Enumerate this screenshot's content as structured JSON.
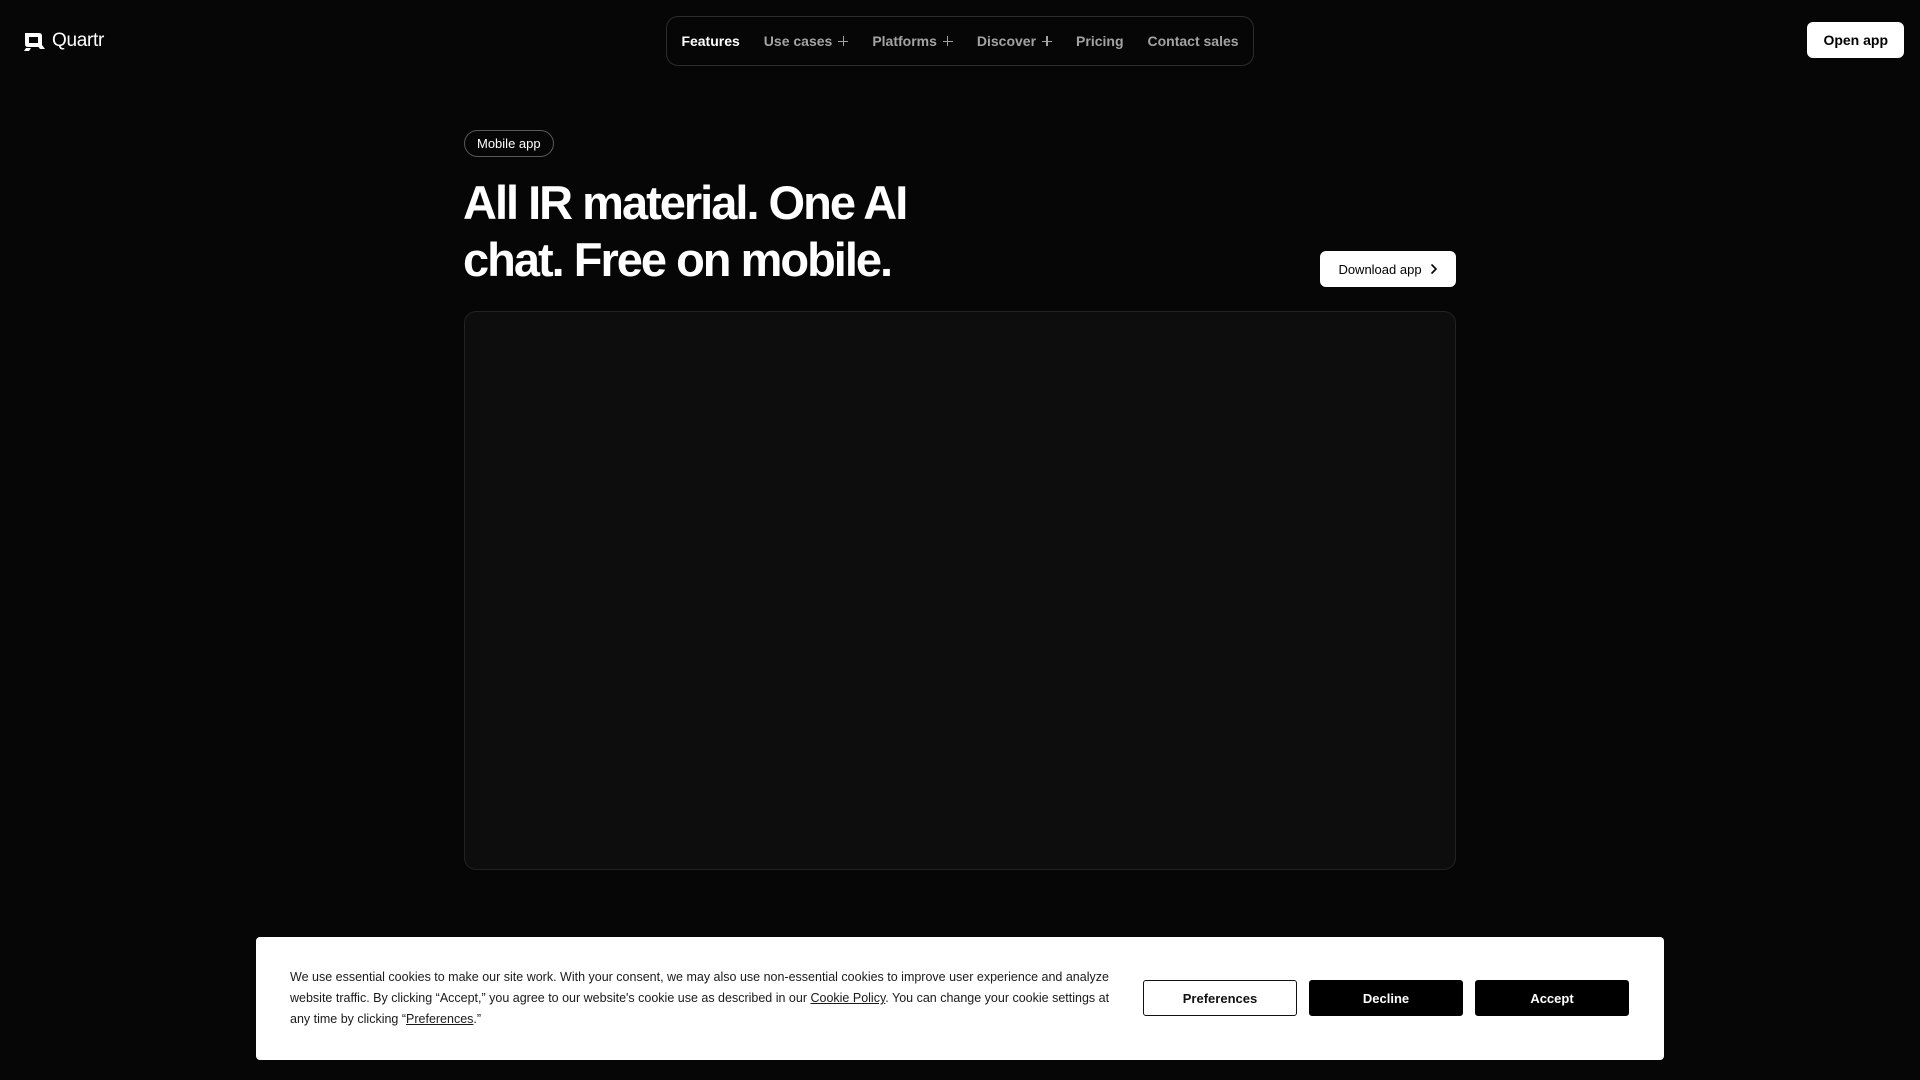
{
  "brand": {
    "name": "Quartr",
    "logo_icon": "quartr-logo-icon"
  },
  "nav": {
    "items": [
      {
        "label": "Features",
        "has_plus": false,
        "active": true
      },
      {
        "label": "Use cases",
        "has_plus": true,
        "active": false
      },
      {
        "label": "Platforms",
        "has_plus": true,
        "active": false
      },
      {
        "label": "Discover",
        "has_plus": true,
        "active": false
      },
      {
        "label": "Pricing",
        "has_plus": false,
        "active": false
      },
      {
        "label": "Contact sales",
        "has_plus": false,
        "active": false
      }
    ]
  },
  "header": {
    "open_app_label": "Open app"
  },
  "hero": {
    "badge": "Mobile app",
    "title_line1": "All IR material. One AI",
    "title_line2": "chat. Free on mobile.",
    "download_label": "Download app"
  },
  "cookie": {
    "text_part1": "We use essential cookies to make our site work. With your consent, we may also use non-essential cookies to improve user experience and analyze website traffic. By clicking “Accept,” you agree to our website's cookie use as described in our ",
    "cookie_policy_link": "Cookie Policy",
    "text_part2": ". You can change your cookie settings at any time by clicking “",
    "preferences_link": "Preferences",
    "text_part3": ".”",
    "preferences_label": "Preferences",
    "decline_label": "Decline",
    "accept_label": "Accept"
  },
  "colors": {
    "background": "#060606",
    "media_frame": "#0d0d0d",
    "nav_border": "#2c2c2c",
    "nav_text_inactive": "#a3a3a3",
    "nav_text_active": "#ffffff"
  }
}
